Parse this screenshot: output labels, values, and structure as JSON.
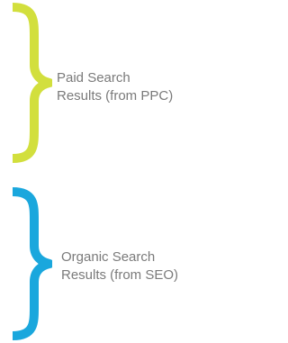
{
  "sections": [
    {
      "label_line1": "Paid Search",
      "label_line2": "Results (from PPC)",
      "color": "#d2df3d"
    },
    {
      "label_line1": "Organic Search",
      "label_line2": "Results (from SEO)",
      "color": "#1aa7dd"
    }
  ]
}
